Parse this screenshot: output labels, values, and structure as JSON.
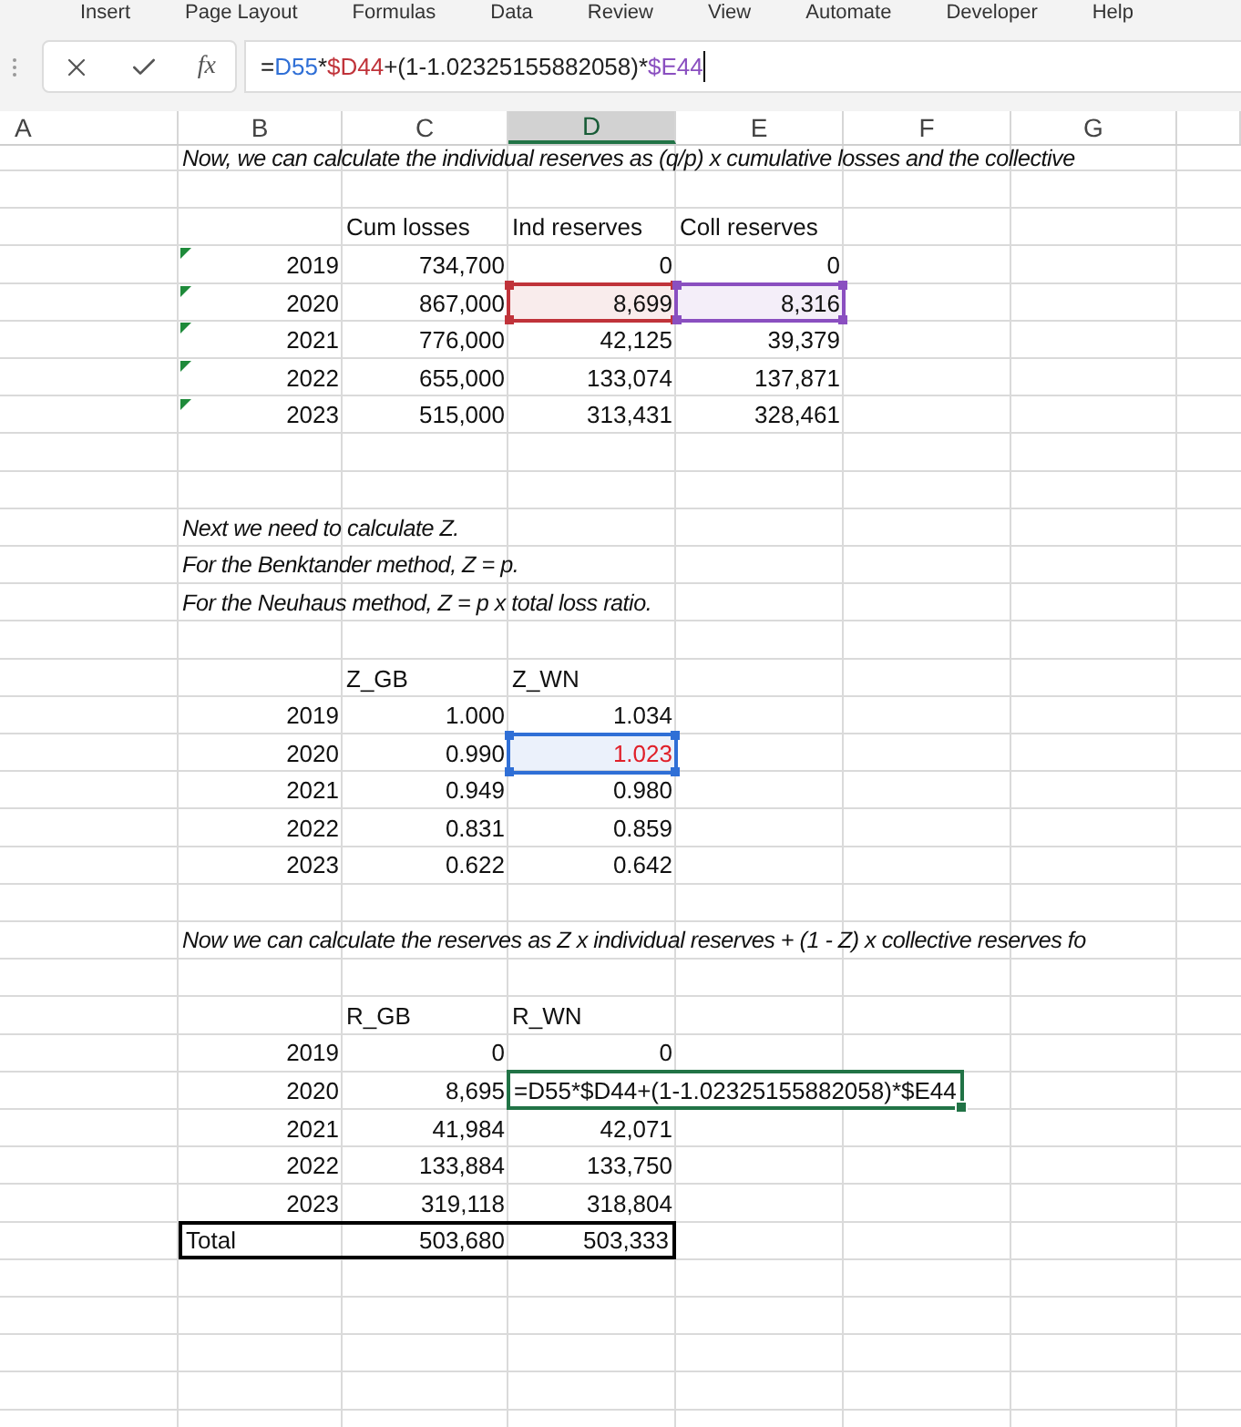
{
  "ribbon": {
    "tabs": [
      {
        "label": "Insert",
        "selected": false
      },
      {
        "label": "Page Layout",
        "selected": false
      },
      {
        "label": "Formulas",
        "selected": false
      },
      {
        "label": "Data",
        "selected": false
      },
      {
        "label": "Review",
        "selected": false
      },
      {
        "label": "View",
        "selected": false
      },
      {
        "label": "Automate",
        "selected": false
      },
      {
        "label": "Developer",
        "selected": false
      },
      {
        "label": "Help",
        "selected": false
      }
    ]
  },
  "formula_bar": {
    "function_label": "fx",
    "segments": [
      {
        "text": "=",
        "color": "#222222"
      },
      {
        "text": "D55",
        "color": "#2f6fd6"
      },
      {
        "text": "*",
        "color": "#222222"
      },
      {
        "text": "$D44",
        "color": "#c0333a"
      },
      {
        "text": "+(1-1.02325155882058)*",
        "color": "#222222"
      },
      {
        "text": "$E44",
        "color": "#8a4fc0"
      }
    ]
  },
  "sheet": {
    "columns": [
      {
        "label": "A",
        "selected": false
      },
      {
        "label": "B",
        "selected": false
      },
      {
        "label": "C",
        "selected": false
      },
      {
        "label": "D",
        "selected": true
      },
      {
        "label": "E",
        "selected": false
      },
      {
        "label": "F",
        "selected": false
      },
      {
        "label": "G",
        "selected": false
      },
      {
        "selected": false
      }
    ],
    "rows": [
      {
        "cut": true,
        "cells": [
          null,
          {
            "kind": "note",
            "text": "Now, we can calculate the individual reserves as (q/p) x cumulative losses and the collective"
          }
        ]
      },
      {
        "cells": []
      },
      {
        "cells": [
          null,
          null,
          {
            "kind": "text",
            "text": "Cum losses"
          },
          {
            "kind": "text",
            "text": "Ind reserves"
          },
          {
            "kind": "text",
            "text": "Coll reserves"
          }
        ]
      },
      {
        "cells": [
          null,
          {
            "kind": "number",
            "text": "2019",
            "flag": true
          },
          {
            "kind": "number",
            "text": "734,700"
          },
          {
            "kind": "number",
            "text": "0"
          },
          {
            "kind": "number",
            "text": "0"
          }
        ]
      },
      {
        "cells": [
          null,
          {
            "kind": "number",
            "text": "2020",
            "flag": true
          },
          {
            "kind": "number",
            "text": "867,000"
          },
          {
            "kind": "number",
            "text": "8,699",
            "color": "#c0333a"
          },
          {
            "kind": "number",
            "text": "8,316",
            "color": "#8a4fc0"
          }
        ]
      },
      {
        "cells": [
          null,
          {
            "kind": "number",
            "text": "2021",
            "flag": true
          },
          {
            "kind": "number",
            "text": "776,000"
          },
          {
            "kind": "number",
            "text": "42,125"
          },
          {
            "kind": "number",
            "text": "39,379"
          }
        ]
      },
      {
        "cells": [
          null,
          {
            "kind": "number",
            "text": "2022",
            "flag": true
          },
          {
            "kind": "number",
            "text": "655,000"
          },
          {
            "kind": "number",
            "text": "133,074"
          },
          {
            "kind": "number",
            "text": "137,871"
          }
        ]
      },
      {
        "cells": [
          null,
          {
            "kind": "number",
            "text": "2023",
            "flag": true
          },
          {
            "kind": "number",
            "text": "515,000"
          },
          {
            "kind": "number",
            "text": "313,431"
          },
          {
            "kind": "number",
            "text": "328,461"
          }
        ]
      },
      {
        "cells": []
      },
      {
        "cells": []
      },
      {
        "cells": [
          null,
          {
            "kind": "note",
            "text": "Next we need to calculate Z."
          }
        ]
      },
      {
        "cells": [
          null,
          {
            "kind": "note",
            "text": "For the Benktander method, Z = p."
          }
        ]
      },
      {
        "cells": [
          null,
          {
            "kind": "note",
            "text": "For the Neuhaus method, Z = p x total loss ratio."
          }
        ]
      },
      {
        "cells": []
      },
      {
        "cells": [
          null,
          null,
          {
            "kind": "text",
            "text": "Z_GB"
          },
          {
            "kind": "text",
            "text": "Z_WN"
          }
        ]
      },
      {
        "cells": [
          null,
          {
            "kind": "number",
            "text": "2019"
          },
          {
            "kind": "number",
            "text": "1.000"
          },
          {
            "kind": "number",
            "text": "1.034"
          }
        ]
      },
      {
        "cells": [
          null,
          {
            "kind": "number",
            "text": "2020"
          },
          {
            "kind": "number",
            "text": "0.990"
          },
          {
            "kind": "number",
            "text": "1.023",
            "color": "#2f6fd6",
            "red_text": true
          }
        ]
      },
      {
        "cells": [
          null,
          {
            "kind": "number",
            "text": "2021"
          },
          {
            "kind": "number",
            "text": "0.949"
          },
          {
            "kind": "number",
            "text": "0.980"
          }
        ]
      },
      {
        "cells": [
          null,
          {
            "kind": "number",
            "text": "2022"
          },
          {
            "kind": "number",
            "text": "0.831"
          },
          {
            "kind": "number",
            "text": "0.859"
          }
        ]
      },
      {
        "cells": [
          null,
          {
            "kind": "number",
            "text": "2023"
          },
          {
            "kind": "number",
            "text": "0.622"
          },
          {
            "kind": "number",
            "text": "0.642"
          }
        ]
      },
      {
        "cells": []
      },
      {
        "cells": [
          null,
          {
            "kind": "note",
            "text": "Now we can calculate the reserves as Z x individual reserves + (1 - Z) x collective reserves fo"
          }
        ]
      },
      {
        "cells": []
      },
      {
        "cells": [
          null,
          null,
          {
            "kind": "text",
            "text": "R_GB"
          },
          {
            "kind": "text",
            "text": "R_WN"
          }
        ]
      },
      {
        "cells": [
          null,
          {
            "kind": "number",
            "text": "2019"
          },
          {
            "kind": "number",
            "text": "0"
          },
          {
            "kind": "number",
            "text": "0"
          }
        ]
      },
      {
        "cells": [
          null,
          {
            "kind": "number",
            "text": "2020"
          },
          {
            "kind": "number",
            "text": "8,695"
          },
          {
            "kind": "editing",
            "text": "=D55*$D44+(1-1.02325155882058)*$E44"
          }
        ]
      },
      {
        "cells": [
          null,
          {
            "kind": "number",
            "text": "2021"
          },
          {
            "kind": "number",
            "text": "41,984"
          },
          {
            "kind": "number",
            "text": "42,071"
          }
        ]
      },
      {
        "cells": [
          null,
          {
            "kind": "number",
            "text": "2022"
          },
          {
            "kind": "number",
            "text": "133,884"
          },
          {
            "kind": "number",
            "text": "133,750"
          }
        ]
      },
      {
        "cells": [
          null,
          {
            "kind": "number",
            "text": "2023"
          },
          {
            "kind": "number",
            "text": "319,118"
          },
          {
            "kind": "number",
            "text": "318,804"
          }
        ]
      },
      {
        "cells": [
          null,
          {
            "kind": "text",
            "text": "Total",
            "boxed": true
          },
          {
            "kind": "number",
            "text": "503,680",
            "boxed": true
          },
          {
            "kind": "number",
            "text": "503,333",
            "boxed": true
          }
        ]
      },
      {
        "cells": []
      },
      {
        "cells": []
      },
      {
        "cells": []
      },
      {
        "cells": []
      },
      {
        "cells": []
      }
    ]
  }
}
